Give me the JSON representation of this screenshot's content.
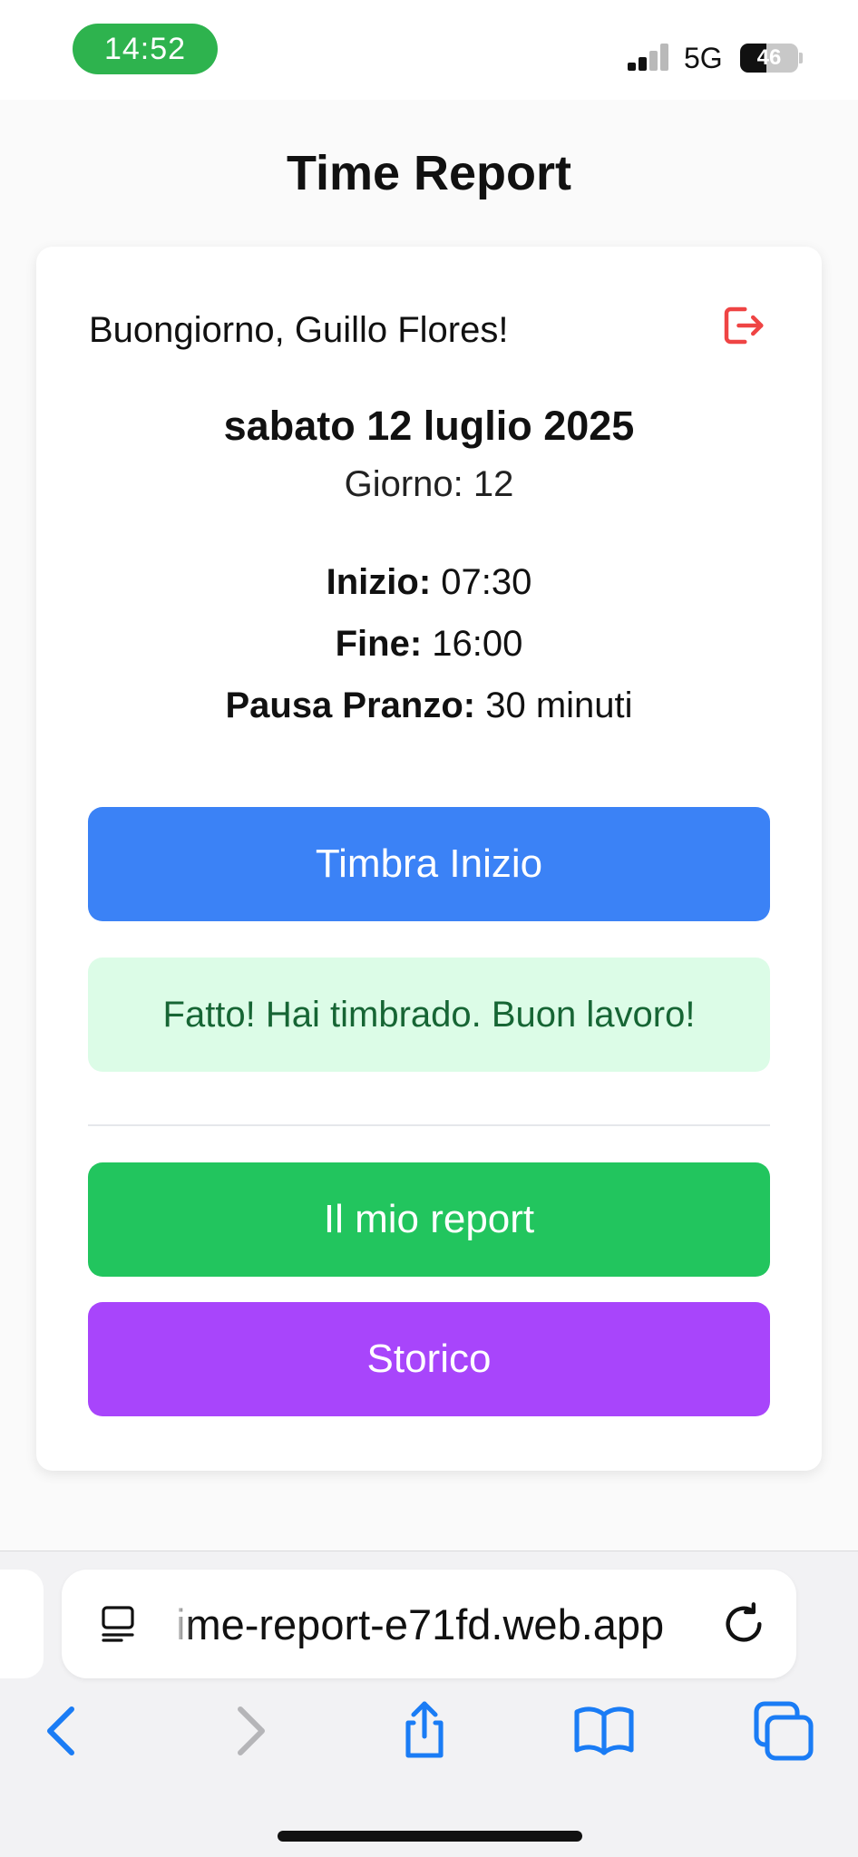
{
  "status_bar": {
    "time": "14:52",
    "network": "5G",
    "battery_level": "46",
    "time_pill_color": "#2eb34e"
  },
  "page": {
    "title": "Time Report"
  },
  "card": {
    "greeting": "Buongiorno, Guillo Flores!",
    "date": "sabato 12 luglio 2025",
    "day": "Giorno: 12",
    "start_label": "Inizio:",
    "start_value": " 07:30",
    "end_label": "Fine:",
    "end_value": " 16:00",
    "lunch_label": "Pausa Pranzo:",
    "lunch_value": " 30 minuti",
    "clock_in_button": "Timbra Inizio",
    "success_message": "Fatto! Hai timbrado. Buon lavoro!",
    "report_button": "Il mio report",
    "history_button": "Storico"
  },
  "browser": {
    "url": "ime-report-e71fd.web.app"
  },
  "colors": {
    "primary_blue": "#3b82f6",
    "success_green": "#22c55e",
    "history_purple": "#a845fb",
    "logout_red": "#ef4444",
    "safari_blue": "#1a7cf5"
  },
  "icons": [
    "logout-icon",
    "tabs-icon",
    "reload-icon",
    "back-icon",
    "forward-icon",
    "share-icon",
    "bookmarks-icon",
    "tabs-overview-icon"
  ]
}
